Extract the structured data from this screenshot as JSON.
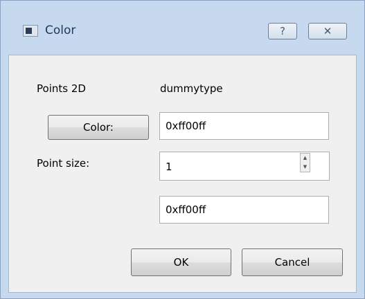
{
  "window": {
    "title": "Color",
    "help_glyph": "?",
    "close_glyph": "✕",
    "title_icon": "window-app-icon"
  },
  "form": {
    "type_label": "Points 2D",
    "type_value": "dummytype",
    "color_button_label": "Color:",
    "color_value": "0xff00ff",
    "point_size_label": "Point size:",
    "point_size_value": "1",
    "second_color_value": "0xff00ff"
  },
  "buttons": {
    "ok_label": "OK",
    "cancel_label": "Cancel"
  },
  "colors": {
    "frame": "#c7d9ee",
    "client": "#f0f0f0",
    "title_text": "#1e395b"
  }
}
